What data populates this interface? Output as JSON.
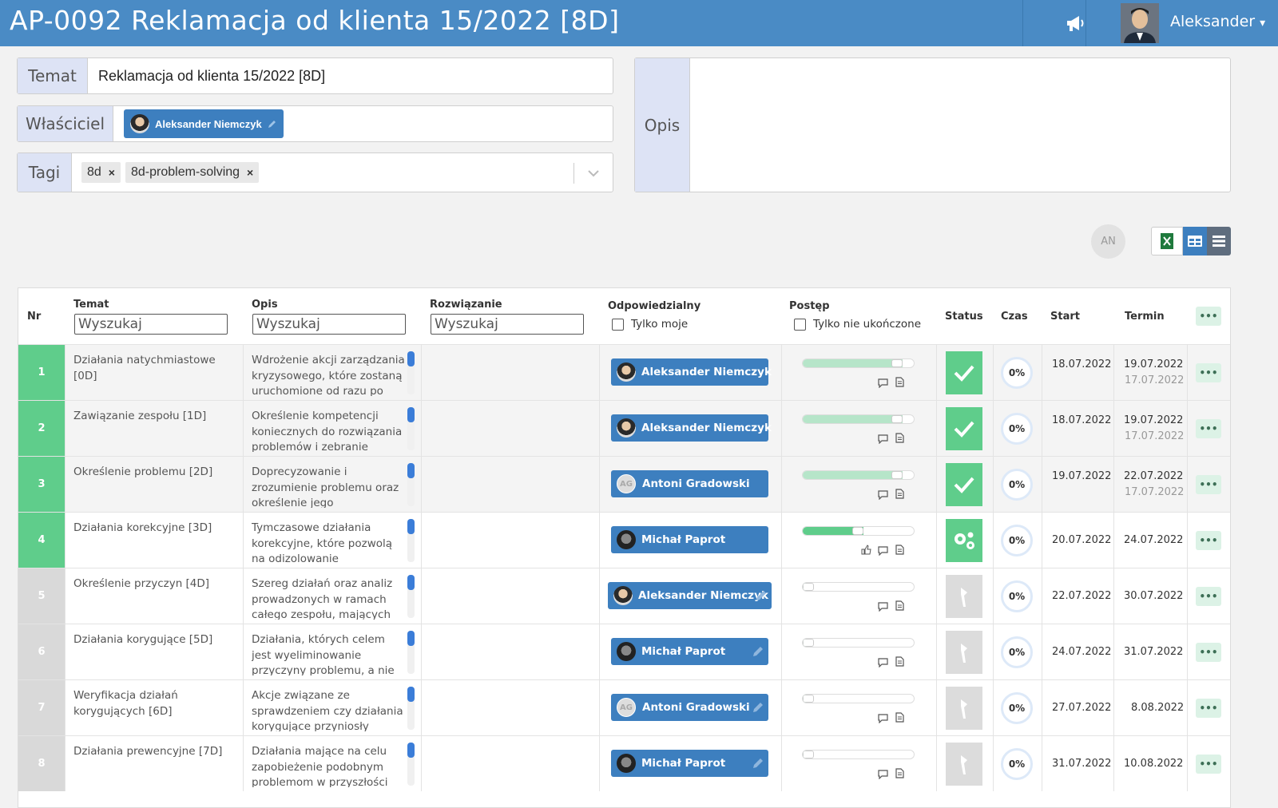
{
  "header": {
    "title": "AP-0092 Reklamacja od klienta 15/2022 [8D]",
    "user_name": "Aleksander",
    "user_menu_caret": "▾"
  },
  "form": {
    "topic_label": "Temat",
    "topic_value": "Reklamacja od klienta 15/2022 [8D]",
    "owner_label": "Właściciel",
    "owner_value": "Aleksander Niemczyk",
    "tags_label": "Tagi",
    "tags": [
      "8d",
      "8d-problem-solving"
    ],
    "tag_remove": "×",
    "description_label": "Opis",
    "description_value": ""
  },
  "toolbar": {
    "filter_avatar_initials": "AN"
  },
  "table": {
    "headers": {
      "nr": "Nr",
      "topic": "Temat",
      "description": "Opis",
      "solution": "Rozwiązanie",
      "responsible": "Odpowiedzialny",
      "progress": "Postęp",
      "status": "Status",
      "time": "Czas",
      "start": "Start",
      "deadline": "Termin",
      "more": "•••"
    },
    "search_placeholder": "Wyszukaj",
    "only_mine_label": "Tylko moje",
    "only_unfinished_label": "Tylko nie ukończone",
    "rows": [
      {
        "nr": "1",
        "topic": "Działania natychmiastowe [0D]",
        "description": "Wdrożenie akcji zarządzania kryzysowego, które zostaną uruchomione od razu po",
        "solution": "",
        "responsible": "Aleksander Niemczyk",
        "responsible_initials": "",
        "progress": 0.9,
        "status": "done",
        "time": "0%",
        "start": "18.07.2022",
        "deadline": "19.07.2022",
        "completed": "17.07.2022",
        "more": "•••"
      },
      {
        "nr": "2",
        "topic": "Zawiązanie zespołu [1D]",
        "description": "Określenie kompetencji koniecznych do rozwiązania problemów i zebranie",
        "solution": "",
        "responsible": "Aleksander Niemczyk",
        "responsible_initials": "",
        "progress": 0.9,
        "status": "done",
        "time": "0%",
        "start": "18.07.2022",
        "deadline": "19.07.2022",
        "completed": "17.07.2022",
        "more": "•••"
      },
      {
        "nr": "3",
        "topic": "Określenie problemu [2D]",
        "description": "Doprecyzowanie i zrozumienie problemu oraz określenie jego",
        "solution": "",
        "responsible": "Antoni Gradowski",
        "responsible_initials": "AG",
        "progress": 0.9,
        "status": "done",
        "time": "0%",
        "start": "19.07.2022",
        "deadline": "22.07.2022",
        "completed": "17.07.2022",
        "more": "•••"
      },
      {
        "nr": "4",
        "topic": "Działania korekcyjne [3D]",
        "description": "Tymczasowe działania korekcyjne, które pozwolą na odizolowanie zaistniałego",
        "solution": "",
        "responsible": "Michał Paprot",
        "responsible_initials": "",
        "progress": 0.55,
        "status": "in-progress",
        "time": "0%",
        "start": "20.07.2022",
        "deadline": "24.07.2022",
        "completed": "",
        "more": "•••"
      },
      {
        "nr": "5",
        "topic": "Określenie przyczyn [4D]",
        "description": "Szereg działań oraz analiz prowadzonych w ramach całego zespołu, mających",
        "solution": "",
        "responsible": "Aleksander Niemczyk",
        "responsible_initials": "",
        "progress": 0.05,
        "status": "not-started",
        "time": "0%",
        "start": "22.07.2022",
        "deadline": "30.07.2022",
        "completed": "",
        "more": "•••"
      },
      {
        "nr": "6",
        "topic": "Działania korygujące [5D]",
        "description": "Działania, których celem jest wyeliminowanie przyczyny problemu, a nie tylko",
        "solution": "",
        "responsible": "Michał Paprot",
        "responsible_initials": "",
        "progress": 0.05,
        "status": "not-started",
        "time": "0%",
        "start": "24.07.2022",
        "deadline": "31.07.2022",
        "completed": "",
        "more": "•••"
      },
      {
        "nr": "7",
        "topic": "Weryfikacja działań korygujących [6D]",
        "description": "Akcje związane ze sprawdzeniem czy działania korygujące przyniosły",
        "solution": "",
        "responsible": "Antoni Gradowski",
        "responsible_initials": "AG",
        "progress": 0.05,
        "status": "not-started",
        "time": "0%",
        "start": "27.07.2022",
        "deadline": "8.08.2022",
        "completed": "",
        "more": "•••"
      },
      {
        "nr": "8",
        "topic": "Działania prewencyjne [7D]",
        "description": "Działania mające na celu zapobieżenie podobnym problemom w przyszłości",
        "solution": "",
        "responsible": "Michał Paprot",
        "responsible_initials": "",
        "progress": 0.05,
        "status": "not-started",
        "time": "0%",
        "start": "31.07.2022",
        "deadline": "10.08.2022",
        "completed": "",
        "more": "•••"
      }
    ]
  },
  "colors": {
    "header_bg": "#4a8bc5",
    "accent_blue": "#3d7fbf",
    "done_green": "#5fcd8b",
    "row_nr_active": "#5fcd8b",
    "row_nr_inactive": "#d9d9d9",
    "progress_done": "#b6e5c9",
    "progress_active": "#5fcd8b",
    "status_inactive": "#dcdcdc"
  }
}
